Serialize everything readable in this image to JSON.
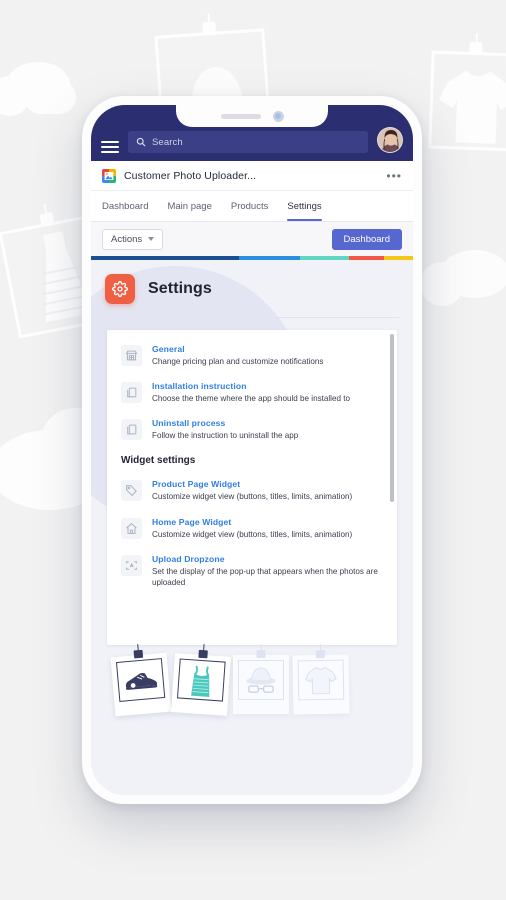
{
  "colors": {
    "navbar": "#2b2f72",
    "accent_indigo": "#5667cf",
    "accent_orange": "#ef5f43",
    "link_blue": "#2f7fe0",
    "page_bg": "#f1f2f8"
  },
  "navbar": {
    "menu_icon": "hamburger-menu-icon",
    "search": {
      "placeholder": "Search",
      "icon": "search-icon",
      "value": ""
    },
    "avatar_alt": "user-avatar"
  },
  "app_row": {
    "icon": "photo-app-icon",
    "title": "Customer Photo Uploader...",
    "more_label": "•••"
  },
  "tabs": [
    {
      "label": "Dashboard",
      "active": false
    },
    {
      "label": "Main page",
      "active": false
    },
    {
      "label": "Products",
      "active": false
    },
    {
      "label": "Settings",
      "active": true
    }
  ],
  "toolbar": {
    "actions_label": "Actions",
    "actions_caret": "chevron-down-icon",
    "dashboard_label": "Dashboard"
  },
  "color_bar": [
    {
      "color": "#1c4f91",
      "width": 46
    },
    {
      "color": "#2b8fe0",
      "width": 19
    },
    {
      "color": "#5fd6c0",
      "width": 15
    },
    {
      "color": "#f0584a",
      "width": 11
    },
    {
      "color": "#f5c718",
      "width": 9
    }
  ],
  "page": {
    "icon": "gear-icon",
    "title": "Settings"
  },
  "settings_list": [
    {
      "icon": "store-icon",
      "title": "General",
      "desc": "Change pricing plan and customize notifications"
    },
    {
      "icon": "document-copy-icon",
      "title": "Installation instruction",
      "desc": "Choose the theme where the app should be installed to"
    },
    {
      "icon": "document-copy-icon",
      "title": "Uninstall process",
      "desc": "Follow the instruction to uninstall the app"
    }
  ],
  "widget_section": {
    "heading": "Widget settings",
    "items": [
      {
        "icon": "tag-icon",
        "title": "Product Page Widget",
        "desc": "Customize widget view (buttons, titles, limits, animation)"
      },
      {
        "icon": "home-icon",
        "title": "Home Page Widget",
        "desc": "Customize widget view (buttons, titles, limits, animation)"
      },
      {
        "icon": "dropzone-icon",
        "title": "Upload Dropzone",
        "desc": "Set the display of the pop-up that appears when the photos are uploaded"
      }
    ]
  },
  "photos": [
    {
      "name": "sneaker-photo",
      "faded": false
    },
    {
      "name": "tank-top-photo",
      "faded": false
    },
    {
      "name": "hat-glasses-photo",
      "faded": true
    },
    {
      "name": "tshirt-photo",
      "faded": true
    }
  ],
  "background": {
    "ghost_photos": [
      "hat-ghost-photo",
      "tshirt-ghost-photo",
      "dress-ghost-photo"
    ],
    "clouds": 3
  }
}
